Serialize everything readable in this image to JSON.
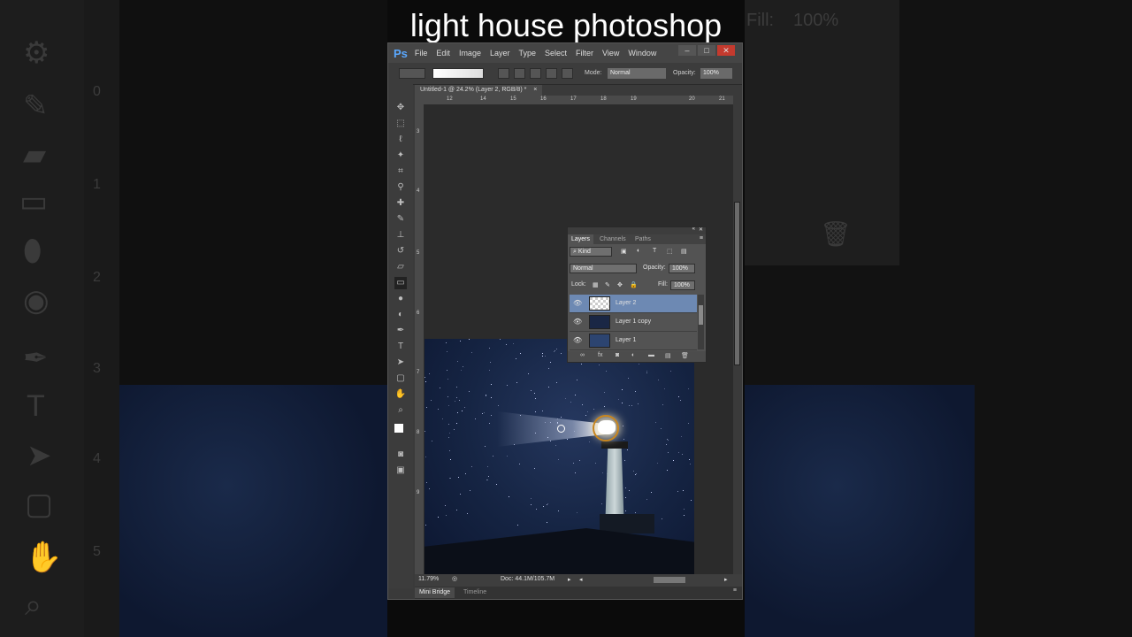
{
  "video_title": "light house photoshop",
  "app": {
    "logo": "Ps",
    "menu": [
      "File",
      "Edit",
      "Image",
      "Layer",
      "Type",
      "Select",
      "Filter",
      "View",
      "Window"
    ],
    "window_controls": [
      "–",
      "□",
      "✕"
    ]
  },
  "options_bar": {
    "mode_label": "Mode:",
    "mode_value": "Normal",
    "opacity_label": "Opacity:",
    "opacity_value": "100%"
  },
  "document_tab": {
    "title": "Untitled-1 @ 24.2% (Layer 2, RGB/8) *",
    "close": "×"
  },
  "rulers": {
    "top": [
      "12",
      "14",
      "15",
      "16",
      "17",
      "18",
      "19",
      "20",
      "21"
    ],
    "left": [
      "3",
      "4",
      "5",
      "6",
      "7",
      "8",
      "9"
    ]
  },
  "status": {
    "zoom": "11.79%",
    "doc": "Doc: 44.1M/105.7M"
  },
  "bottom_tabs": [
    "Mini Bridge",
    "Timeline"
  ],
  "layers_panel": {
    "tabs": [
      "Layers",
      "Channels",
      "Paths"
    ],
    "filter_kind": "Kind",
    "blend_mode": "Normal",
    "opacity_label": "Opacity:",
    "opacity_value": "100%",
    "lock_label": "Lock:",
    "fill_label": "Fill:",
    "fill_value": "100%",
    "layers": [
      {
        "name": "Layer 2",
        "selected": true
      },
      {
        "name": "Layer 1 copy",
        "selected": false
      },
      {
        "name": "Layer 1",
        "selected": false
      }
    ],
    "footer_icons": [
      "link-icon",
      "fx-icon",
      "mask-icon",
      "adjustment-icon",
      "folder-icon",
      "new-layer-icon",
      "trash-icon"
    ]
  },
  "background": {
    "left_numbers": [
      "0",
      "1",
      "2",
      "3",
      "4",
      "5"
    ],
    "right_fill_label": "Fill:",
    "right_fill_value": "100%"
  }
}
